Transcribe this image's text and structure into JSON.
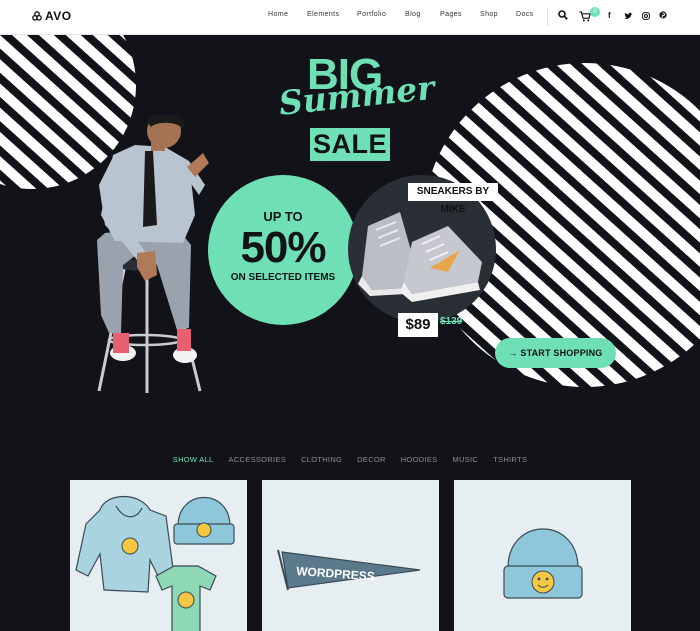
{
  "brand": {
    "logo_text": "AVO"
  },
  "nav": {
    "items": [
      "Home",
      "Elements",
      "Portfolio",
      "Blog",
      "Pages",
      "Shop",
      "Docs"
    ],
    "cart_count": "0",
    "social": [
      "facebook-icon",
      "twitter-icon",
      "instagram-icon",
      "pinterest-icon"
    ]
  },
  "hero": {
    "big": "BIG",
    "summer": "Summer",
    "sale": "SALE",
    "up_to": "UP TO",
    "percent": "50%",
    "selected": "ON SELECTED ITEMS",
    "sneakers_label": "SNEAKERS BY MIKE",
    "price": "$89",
    "old_price": "$139",
    "cta_label": "→ START SHOPPING"
  },
  "filters": {
    "items": [
      "SHOW ALL",
      "ACCESSORIES",
      "CLOTHING",
      "DECOR",
      "HOODIES",
      "MUSIC",
      "TSHIRTS"
    ],
    "active": "SHOW ALL"
  },
  "products": [
    {
      "name": "hoodie-hat-tshirt"
    },
    {
      "name": "wordpress-pennant",
      "pennant_text": "WORDPRESS"
    },
    {
      "name": "beanie"
    }
  ],
  "colors": {
    "accent": "#6fe0b5",
    "background": "#111318",
    "white": "#ffffff",
    "product_bg": "#e6eef1"
  }
}
